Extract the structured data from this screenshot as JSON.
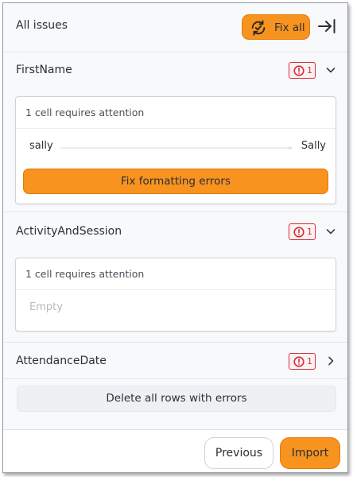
{
  "colors": {
    "accent": "#f7931e",
    "error": "#d62d3a",
    "panel_bg": "#f8f9fb"
  },
  "header": {
    "title": "All issues",
    "fix_all_label": "Fix all",
    "fix_all_icon": "refresh-icon",
    "collapse_icon": "arrow-right-to-line-icon"
  },
  "sections": [
    {
      "name": "FirstName",
      "error_count": "1",
      "expanded": true,
      "chevron_icon": "chevron-down-icon",
      "card": {
        "heading": "1 cell requires attention",
        "from_value": "sally",
        "to_value": "Sally",
        "fix_button_label": "Fix formatting errors"
      }
    },
    {
      "name": "ActivityAndSession",
      "error_count": "1",
      "expanded": true,
      "chevron_icon": "chevron-down-icon",
      "card": {
        "heading": "1 cell requires attention",
        "placeholder": "Empty"
      }
    },
    {
      "name": "AttendanceDate",
      "error_count": "1",
      "expanded": false,
      "chevron_icon": "chevron-right-icon"
    }
  ],
  "delete_all_label": "Delete all rows with errors",
  "footer": {
    "previous_label": "Previous",
    "import_label": "Import"
  }
}
